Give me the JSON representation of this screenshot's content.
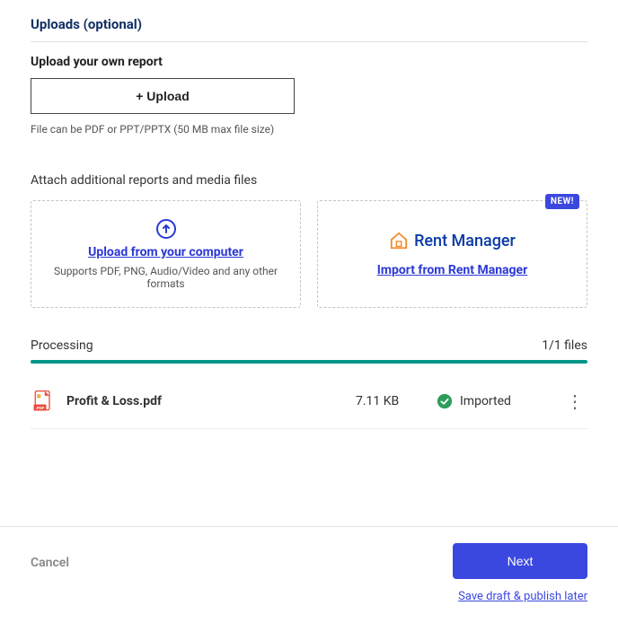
{
  "section_title": "Uploads (optional)",
  "upload_report": {
    "heading": "Upload your own report",
    "button_label": "+ Upload",
    "hint": "File can be PDF or PPT/PPTX (50 MB max file size)"
  },
  "attach": {
    "heading": "Attach additional reports and media files",
    "computer_card": {
      "link_label": "Upload from your computer",
      "supports": "Supports PDF, PNG, Audio/Video and any other formats"
    },
    "rentmanager_card": {
      "badge": "NEW!",
      "logo_text": "Rent Manager",
      "link_label": "Import from Rent Manager"
    }
  },
  "processing": {
    "label": "Processing",
    "count_label": "1/1 files",
    "progress_percent": 100
  },
  "file": {
    "name": "Profit & Loss.pdf",
    "size": "7.11 KB",
    "status": "Imported"
  },
  "footer": {
    "cancel": "Cancel",
    "next": "Next",
    "save_link": "Save draft & publish later"
  },
  "colors": {
    "accent": "#3b48e0",
    "progress": "#009688"
  }
}
